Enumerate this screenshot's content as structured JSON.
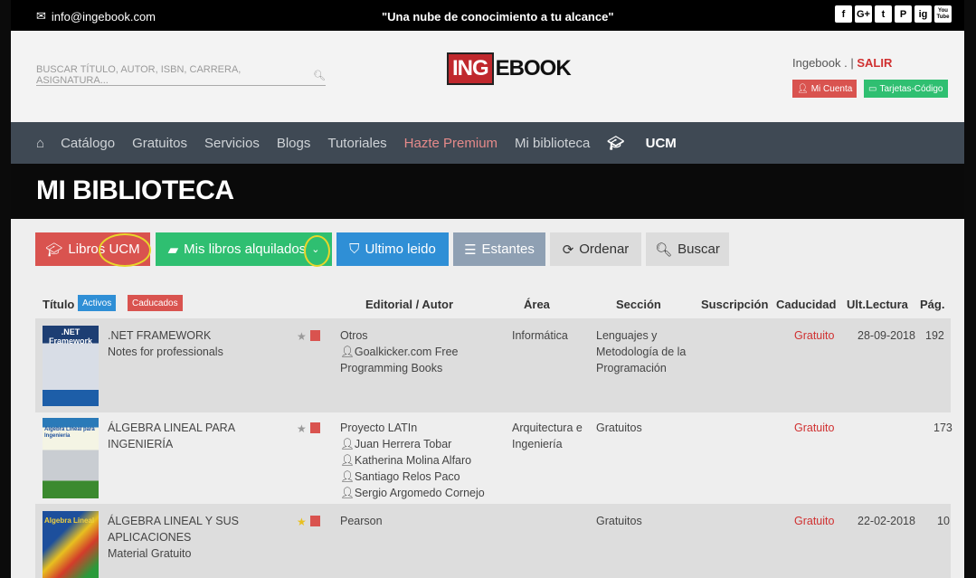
{
  "topbar": {
    "email": "info@ingebook.com",
    "slogan": "\"Una nube de conocimiento a tu alcance\"",
    "social": [
      "f",
      "G+",
      "t",
      "P",
      "ig",
      "You Tube"
    ]
  },
  "header": {
    "search_placeholder": "BUSCAR TÍTULO, AUTOR, ISBN, CARRERA, ASIGNATURA...",
    "logo_ing": "ING",
    "logo_ebook": "EBOOK",
    "user_name": "Ingebook .",
    "separator": "|",
    "salir": "SALIR",
    "mi_cuenta": "Mi Cuenta",
    "tarjetas": "Tarjetas-Código"
  },
  "nav": {
    "items": [
      "Catálogo",
      "Gratuitos",
      "Servicios",
      "Blogs",
      "Tutoriales",
      "Hazte Premium",
      "Mi biblioteca",
      "UCM"
    ]
  },
  "page_title": "MI BIBLIOTECA",
  "tabs": {
    "libros_ucm": "Libros UCM",
    "mis_libros": "Mis libros alquilados",
    "ultimo": "Ultimo leido",
    "estantes": "Estantes",
    "ordenar": "Ordenar",
    "buscar": "Buscar"
  },
  "table": {
    "headers": {
      "titulo": "Título",
      "activos": "Activos",
      "caducados": "Caducados",
      "editorial": "Editorial / Autor",
      "area": "Área",
      "seccion": "Sección",
      "suscripcion": "Suscripción",
      "caducidad": "Caducidad",
      "ult": "Ult.Lectura",
      "pag": "Pág."
    },
    "rows": [
      {
        "title": ".NET FRAMEWORK",
        "subtitle": "Notes for professionals",
        "editorial": "Otros",
        "authors": [
          "Goalkicker.com Free",
          "Programming Books"
        ],
        "area": "Informática",
        "seccion": "Lenguajes y Metodología de la Programación",
        "caducidad": "Gratuito",
        "ult": "28-09-2018",
        "pag": "192",
        "cover_title": ".NET Framework"
      },
      {
        "title": "ÁLGEBRA LINEAL PARA INGENIERÍA",
        "subtitle": "",
        "editorial": "Proyecto LATIn",
        "authors": [
          "Juan Herrera Tobar",
          "Katherina Molina Alfaro",
          "Santiago Relos Paco",
          "Sergio Argomedo Cornejo"
        ],
        "area": "Arquitectura e Ingeniería",
        "seccion": "Gratuitos",
        "caducidad": "Gratuito",
        "ult": "",
        "pag": "173",
        "cover_title": "Algebra Lineal para Ingeniería"
      },
      {
        "title": "ÁLGEBRA LINEAL Y SUS APLICACIONES",
        "subtitle": "Material Gratuito",
        "editorial": "Pearson",
        "authors": [],
        "area": "",
        "seccion": "Gratuitos",
        "caducidad": "Gratuito",
        "ult": "22-02-2018",
        "pag": "10",
        "cover_title": "Algebra Lineal"
      }
    ]
  },
  "colors": {
    "accent_red": "#d9534f",
    "green": "#2fbf71",
    "blue": "#2f8fd6",
    "nav": "#3f4954"
  }
}
